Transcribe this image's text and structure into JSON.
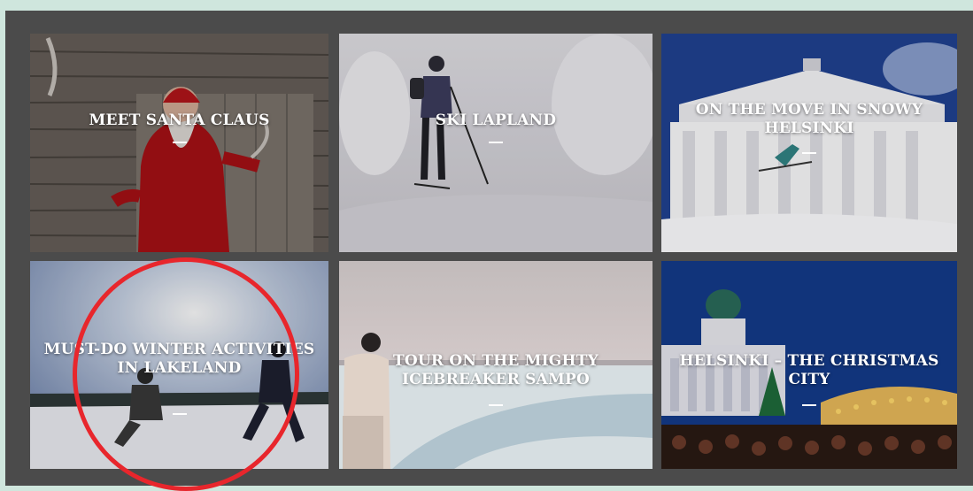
{
  "tiles": [
    {
      "title": "MEET SANTA CLAUS"
    },
    {
      "title": "SKI LAPLAND"
    },
    {
      "title": "ON THE MOVE IN SNOWY HELSINKI"
    },
    {
      "title": "MUST-DO WINTER ACTIVITIES IN LAKELAND"
    },
    {
      "title": "TOUR ON THE MIGHTY ICEBREAKER SAMPO"
    },
    {
      "title": "HELSINKI – THE CHRISTMAS CITY"
    }
  ],
  "highlight": {
    "color": "#e8262c",
    "target": "MUST-DO WINTER ACTIVITIES IN LAKELAND"
  },
  "colors": {
    "frame": "#4b4b4b",
    "background": "#cfe6dd",
    "caption": "#ffffff"
  }
}
